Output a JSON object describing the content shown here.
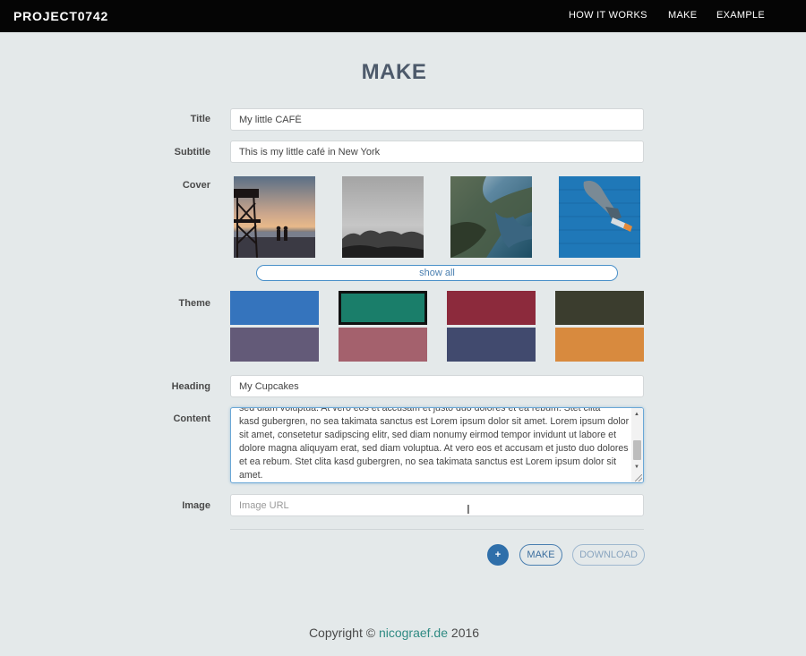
{
  "navbar": {
    "brand": "PROJECT0742",
    "links": [
      "HOW IT WORKS",
      "MAKE",
      "EXAMPLE"
    ]
  },
  "page": {
    "title": "MAKE"
  },
  "form": {
    "title_label": "Title",
    "title_value": "My little CAFÉ",
    "subtitle_label": "Subtitle",
    "subtitle_value": "This is my little café in New York",
    "cover_label": "Cover",
    "covers": [
      "lifeguard-tower-sunset-photo",
      "grayscale-landscape-photo",
      "coastal-aerial-photo",
      "jumping-person-blue-wall-photo"
    ],
    "show_all_label": "show all",
    "theme_label": "Theme",
    "themes": [
      "#3574bd",
      "#1a7e6a",
      "#8c2a3c",
      "#3b3d2e",
      "#635a78",
      "#a4616d",
      "#414a6e",
      "#d88a3e"
    ],
    "selected_theme": 1,
    "heading_label": "Heading",
    "heading_value": "My Cupcakes",
    "content_label": "Content",
    "content_partial_line": "sed diam voluptua. At vero eos et accusam et justo duo dolores et ea rebum. Stet clita",
    "content_value": "kasd gubergren, no sea takimata sanctus est Lorem ipsum dolor sit amet. Lorem ipsum dolor sit amet, consetetur sadipscing elitr, sed diam nonumy eirmod tempor invidunt ut labore et dolore magna aliquyam erat, sed diam voluptua. At vero eos et accusam et justo duo dolores et ea rebum. Stet clita kasd gubergren, no sea takimata sanctus est Lorem ipsum dolor sit amet.",
    "image_label": "Image",
    "image_placeholder": "Image URL"
  },
  "actions": {
    "add_label": "+",
    "make_label": "MAKE",
    "download_label": "DOWNLOAD"
  },
  "footer": {
    "prefix": "Copyright ©",
    "link": "nicograef.de",
    "year": "2016"
  }
}
